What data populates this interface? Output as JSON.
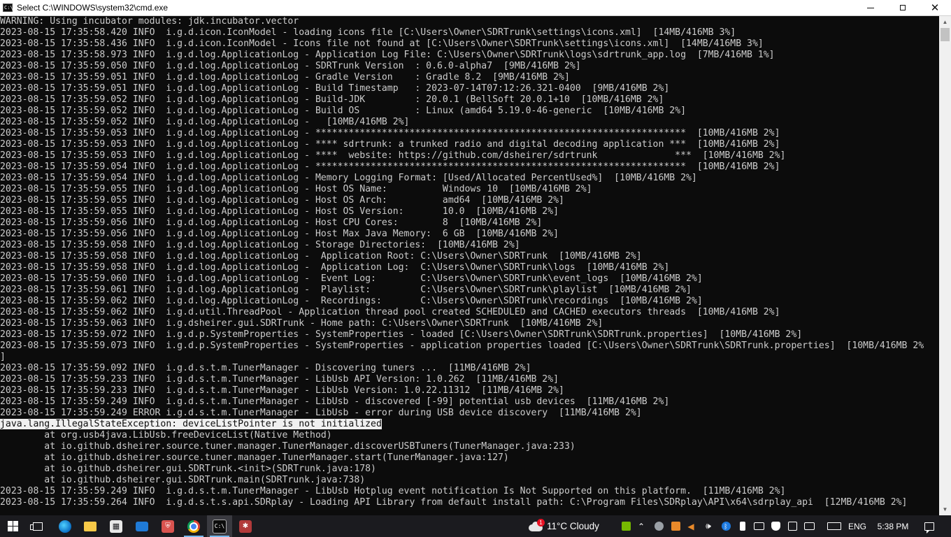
{
  "window": {
    "title": "Select C:\\WINDOWS\\system32\\cmd.exe",
    "app_icon_text": "C:\\",
    "minimize_glyph": "",
    "maximize_glyph": "",
    "close_glyph": "✕"
  },
  "console": {
    "selected_line_index": 36,
    "lines": [
      "WARNING: Using incubator modules: jdk.incubator.vector",
      "2023-08-15 17:35:58.420 INFO  i.g.d.icon.IconModel - loading icons file [C:\\Users\\Owner\\SDRTrunk\\settings\\icons.xml]  [14MB/416MB 3%]",
      "2023-08-15 17:35:58.436 INFO  i.g.d.icon.IconModel - Icons file not found at [C:\\Users\\Owner\\SDRTrunk\\settings\\icons.xml]  [14MB/416MB 3%]",
      "2023-08-15 17:35:58.973 INFO  i.g.d.log.ApplicationLog - Application Log File: C:\\Users\\Owner\\SDRTrunk\\logs\\sdrtrunk_app.log  [7MB/416MB 1%]",
      "2023-08-15 17:35:59.050 INFO  i.g.d.log.ApplicationLog - SDRTrunk Version  : 0.6.0-alpha7  [9MB/416MB 2%]",
      "2023-08-15 17:35:59.051 INFO  i.g.d.log.ApplicationLog - Gradle Version    : Gradle 8.2  [9MB/416MB 2%]",
      "2023-08-15 17:35:59.051 INFO  i.g.d.log.ApplicationLog - Build Timestamp   : 2023-07-14T07:12:26.321-0400  [9MB/416MB 2%]",
      "2023-08-15 17:35:59.052 INFO  i.g.d.log.ApplicationLog - Build-JDK         : 20.0.1 (BellSoft 20.0.1+10  [10MB/416MB 2%]",
      "2023-08-15 17:35:59.052 INFO  i.g.d.log.ApplicationLog - Build OS          : Linux (amd64 5.19.0-46-generic  [10MB/416MB 2%]",
      "2023-08-15 17:35:59.052 INFO  i.g.d.log.ApplicationLog -   [10MB/416MB 2%]",
      "2023-08-15 17:35:59.053 INFO  i.g.d.log.ApplicationLog - *******************************************************************  [10MB/416MB 2%]",
      "2023-08-15 17:35:59.053 INFO  i.g.d.log.ApplicationLog - **** sdrtrunk: a trunked radio and digital decoding application ***  [10MB/416MB 2%]",
      "2023-08-15 17:35:59.053 INFO  i.g.d.log.ApplicationLog - ****  website: https://github.com/dsheirer/sdrtrunk              ***  [10MB/416MB 2%]",
      "2023-08-15 17:35:59.054 INFO  i.g.d.log.ApplicationLog - *******************************************************************  [10MB/416MB 2%]",
      "2023-08-15 17:35:59.054 INFO  i.g.d.log.ApplicationLog - Memory Logging Format: [Used/Allocated PercentUsed%]  [10MB/416MB 2%]",
      "2023-08-15 17:35:59.055 INFO  i.g.d.log.ApplicationLog - Host OS Name:          Windows 10  [10MB/416MB 2%]",
      "2023-08-15 17:35:59.055 INFO  i.g.d.log.ApplicationLog - Host OS Arch:          amd64  [10MB/416MB 2%]",
      "2023-08-15 17:35:59.055 INFO  i.g.d.log.ApplicationLog - Host OS Version:       10.0  [10MB/416MB 2%]",
      "2023-08-15 17:35:59.056 INFO  i.g.d.log.ApplicationLog - Host CPU Cores:        8  [10MB/416MB 2%]",
      "2023-08-15 17:35:59.056 INFO  i.g.d.log.ApplicationLog - Host Max Java Memory:  6 GB  [10MB/416MB 2%]",
      "2023-08-15 17:35:59.058 INFO  i.g.d.log.ApplicationLog - Storage Directories:  [10MB/416MB 2%]",
      "2023-08-15 17:35:59.058 INFO  i.g.d.log.ApplicationLog -  Application Root: C:\\Users\\Owner\\SDRTrunk  [10MB/416MB 2%]",
      "2023-08-15 17:35:59.058 INFO  i.g.d.log.ApplicationLog -  Application Log:  C:\\Users\\Owner\\SDRTrunk\\logs  [10MB/416MB 2%]",
      "2023-08-15 17:35:59.060 INFO  i.g.d.log.ApplicationLog -  Event Log:        C:\\Users\\Owner\\SDRTrunk\\event_logs  [10MB/416MB 2%]",
      "2023-08-15 17:35:59.061 INFO  i.g.d.log.ApplicationLog -  Playlist:         C:\\Users\\Owner\\SDRTrunk\\playlist  [10MB/416MB 2%]",
      "2023-08-15 17:35:59.062 INFO  i.g.d.log.ApplicationLog -  Recordings:       C:\\Users\\Owner\\SDRTrunk\\recordings  [10MB/416MB 2%]",
      "2023-08-15 17:35:59.062 INFO  i.g.d.util.ThreadPool - Application thread pool created SCHEDULED and CACHED executors threads  [10MB/416MB 2%]",
      "2023-08-15 17:35:59.063 INFO  i.g.dsheirer.gui.SDRTrunk - Home path: C:\\Users\\Owner\\SDRTrunk  [10MB/416MB 2%]",
      "2023-08-15 17:35:59.072 INFO  i.g.d.p.SystemProperties - SystemProperties - loaded [C:\\Users\\Owner\\SDRTrunk\\SDRTrunk.properties]  [10MB/416MB 2%]",
      "2023-08-15 17:35:59.073 INFO  i.g.d.p.SystemProperties - SystemProperties - application properties loaded [C:\\Users\\Owner\\SDRTrunk\\SDRTrunk.properties]  [10MB/416MB 2%",
      "]",
      "2023-08-15 17:35:59.092 INFO  i.g.d.s.t.m.TunerManager - Discovering tuners ...  [11MB/416MB 2%]",
      "2023-08-15 17:35:59.233 INFO  i.g.d.s.t.m.TunerManager - LibUsb API Version: 1.0.262  [11MB/416MB 2%]",
      "2023-08-15 17:35:59.233 INFO  i.g.d.s.t.m.TunerManager - LibUsb Version: 1.0.22.11312  [11MB/416MB 2%]",
      "2023-08-15 17:35:59.249 INFO  i.g.d.s.t.m.TunerManager - LibUsb - discovered [-99] potential usb devices  [11MB/416MB 2%]",
      "2023-08-15 17:35:59.249 ERROR i.g.d.s.t.m.TunerManager - LibUsb - error during USB device discovery  [11MB/416MB 2%]",
      "java.lang.IllegalStateException: deviceListPointer is not initialized",
      "        at org.usb4java.LibUsb.freeDeviceList(Native Method)",
      "        at io.github.dsheirer.source.tuner.manager.TunerManager.discoverUSBTuners(TunerManager.java:233)",
      "        at io.github.dsheirer.source.tuner.manager.TunerManager.start(TunerManager.java:127)",
      "        at io.github.dsheirer.gui.SDRTrunk.<init>(SDRTrunk.java:178)",
      "        at io.github.dsheirer.gui.SDRTrunk.main(SDRTrunk.java:738)",
      "2023-08-15 17:35:59.249 INFO  i.g.d.s.t.m.TunerManager - LibUsb Hotplug event notification Is Not Supported on this platform.  [11MB/416MB 2%]",
      "2023-08-15 17:35:59.264 INFO  i.g.d.s.t.s.api.SDRplay - Loading API Library from default install path: C:\\Program Files\\SDRplay\\API\\x64\\sdrplay_api  [12MB/416MB 2%]"
    ]
  },
  "scrollbar": {
    "up_glyph": "▲",
    "down_glyph": "▼"
  },
  "taskbar": {
    "weather_badge": "1",
    "weather_text": "11°C  Cloudy",
    "language": "ENG",
    "time": "5:38 PM",
    "icons": {
      "store": "▦",
      "shield": "⛨",
      "sdr": "✱",
      "cmd": "C:\\"
    },
    "tray_glyphs": {
      "chevron": "⌃",
      "speaker_mute": "◀",
      "volume": "🕪",
      "bluetooth": "ᛒ"
    },
    "accent": "#76b9ed"
  }
}
